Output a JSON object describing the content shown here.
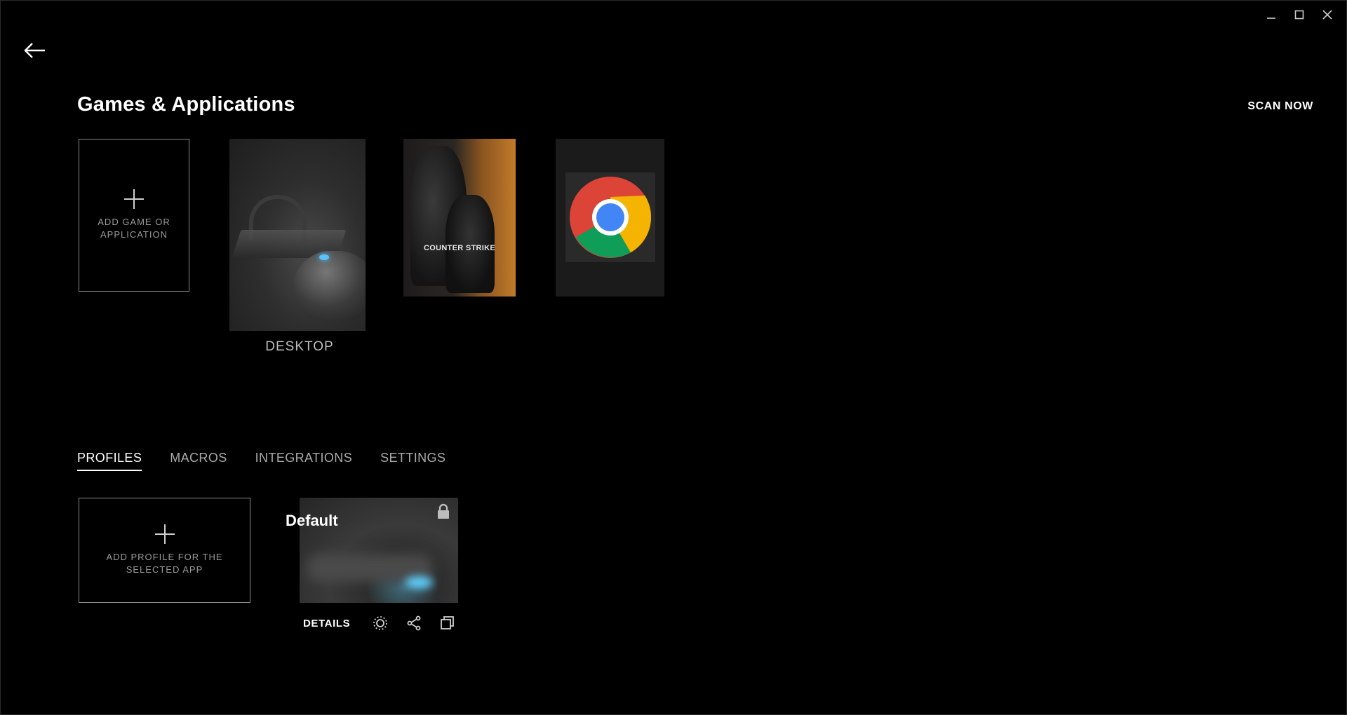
{
  "window": {
    "controls": [
      "minimize-icon",
      "maximize-icon",
      "close-icon"
    ]
  },
  "nav": {
    "back_icon": "arrow-left-icon"
  },
  "header": {
    "title": "Games & Applications",
    "scan_label": "SCAN NOW"
  },
  "games": {
    "add_label": "ADD GAME OR APPLICATION",
    "items": [
      {
        "label": "DESKTOP"
      },
      {
        "logo_text": "COUNTER STRIKE"
      },
      {
        "icon": "chrome-icon"
      }
    ]
  },
  "tabs": [
    {
      "label": "PROFILES",
      "active": true
    },
    {
      "label": "MACROS",
      "active": false
    },
    {
      "label": "INTEGRATIONS",
      "active": false
    },
    {
      "label": "SETTINGS",
      "active": false
    }
  ],
  "profiles": {
    "add_label": "ADD PROFILE FOR THE SELECTED APP",
    "items": [
      {
        "name": "Default",
        "locked": true
      }
    ],
    "actions": {
      "details_label": "DETAILS",
      "icons": [
        "lighting-icon",
        "share-icon",
        "duplicate-icon"
      ]
    }
  },
  "colors": {
    "background": "#000000",
    "text": "#ffffff",
    "muted": "#9a9a9a",
    "accent_led": "#56c3ff"
  }
}
